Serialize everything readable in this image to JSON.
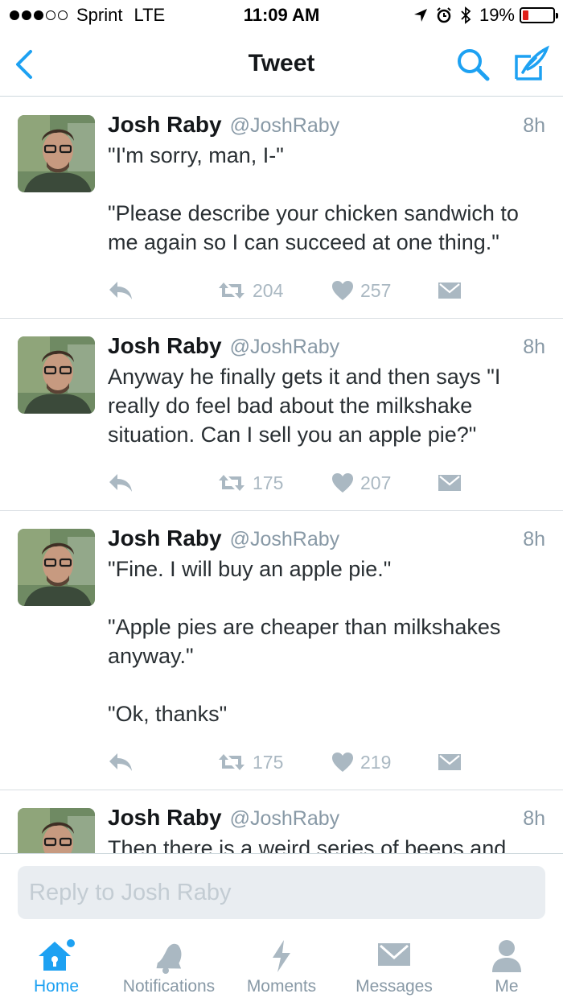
{
  "status_bar": {
    "carrier": "Sprint",
    "network": "LTE",
    "time": "11:09 AM",
    "battery": "19%",
    "battery_level": 0.19,
    "signal_bars_filled": 3,
    "signal_bars_total": 5,
    "icons": [
      "location-arrow-icon",
      "alarm-icon",
      "bluetooth-icon",
      "battery-icon"
    ]
  },
  "nav": {
    "title": "Tweet",
    "icons": [
      "back-chevron-icon",
      "search-icon",
      "compose-icon"
    ],
    "accent": "#1da1f2"
  },
  "tweets": [
    {
      "name": "Josh Raby",
      "handle": "@JoshRaby",
      "time": "8h",
      "text": "\"I'm sorry, man, I-\"\n\n\"Please describe your chicken sandwich to me again so I can succeed at one thing.\"",
      "retweets": "204",
      "likes": "257"
    },
    {
      "name": "Josh Raby",
      "handle": "@JoshRaby",
      "time": "8h",
      "text": "Anyway he finally gets it and then says \"I really do feel bad about the milkshake situation. Can I sell you an apple pie?\"",
      "retweets": "175",
      "likes": "207"
    },
    {
      "name": "Josh Raby",
      "handle": "@JoshRaby",
      "time": "8h",
      "text": "\"Fine. I will buy an apple pie.\"\n\n\"Apple pies are cheaper than milkshakes anyway.\"\n\n\"Ok, thanks\"",
      "retweets": "175",
      "likes": "219"
    },
    {
      "name": "Josh Raby",
      "handle": "@JoshRaby",
      "time": "8h",
      "text": "Then there is a weird series of beeps and",
      "retweets": "",
      "likes": ""
    }
  ],
  "reply": {
    "placeholder": "Reply to Josh Raby"
  },
  "tabs": [
    {
      "label": "Home",
      "icon": "home-icon",
      "active": true
    },
    {
      "label": "Notifications",
      "icon": "bell-icon",
      "active": false
    },
    {
      "label": "Moments",
      "icon": "lightning-icon",
      "active": false
    },
    {
      "label": "Messages",
      "icon": "envelope-icon",
      "active": false
    },
    {
      "label": "Me",
      "icon": "person-icon",
      "active": false
    }
  ],
  "colors": {
    "accent": "#1da1f2",
    "muted": "#8899a6",
    "action_gray": "#aab8c2",
    "battery_low": "#e0201a"
  }
}
